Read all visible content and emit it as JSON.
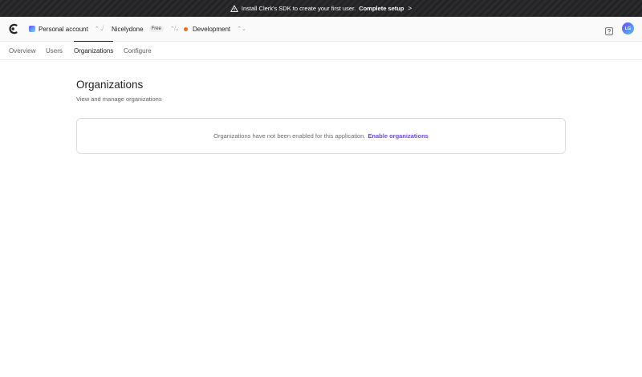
{
  "banner": {
    "text": "Install Clerk's SDK to create your first user.",
    "link": "Complete setup",
    "chevron": ">"
  },
  "header": {
    "account": "Personal account",
    "application": "Nicelydone",
    "plan_badge": "Free",
    "environment": "Development",
    "updown": "⌃⌄",
    "separator": "/",
    "avatar_initials": "LG"
  },
  "tabs": [
    {
      "label": "Overview"
    },
    {
      "label": "Users"
    },
    {
      "label": "Organizations"
    },
    {
      "label": "Configure"
    }
  ],
  "main": {
    "title": "Organizations",
    "subtitle": "View and manage organizations",
    "notice_text": "Organizations have not been enabled for this application.",
    "notice_link": "Enable organizations"
  },
  "colors": {
    "accent": "#6c47ff",
    "environment_dot": "#f36b16",
    "banner_bg": "#2b2b2e"
  }
}
